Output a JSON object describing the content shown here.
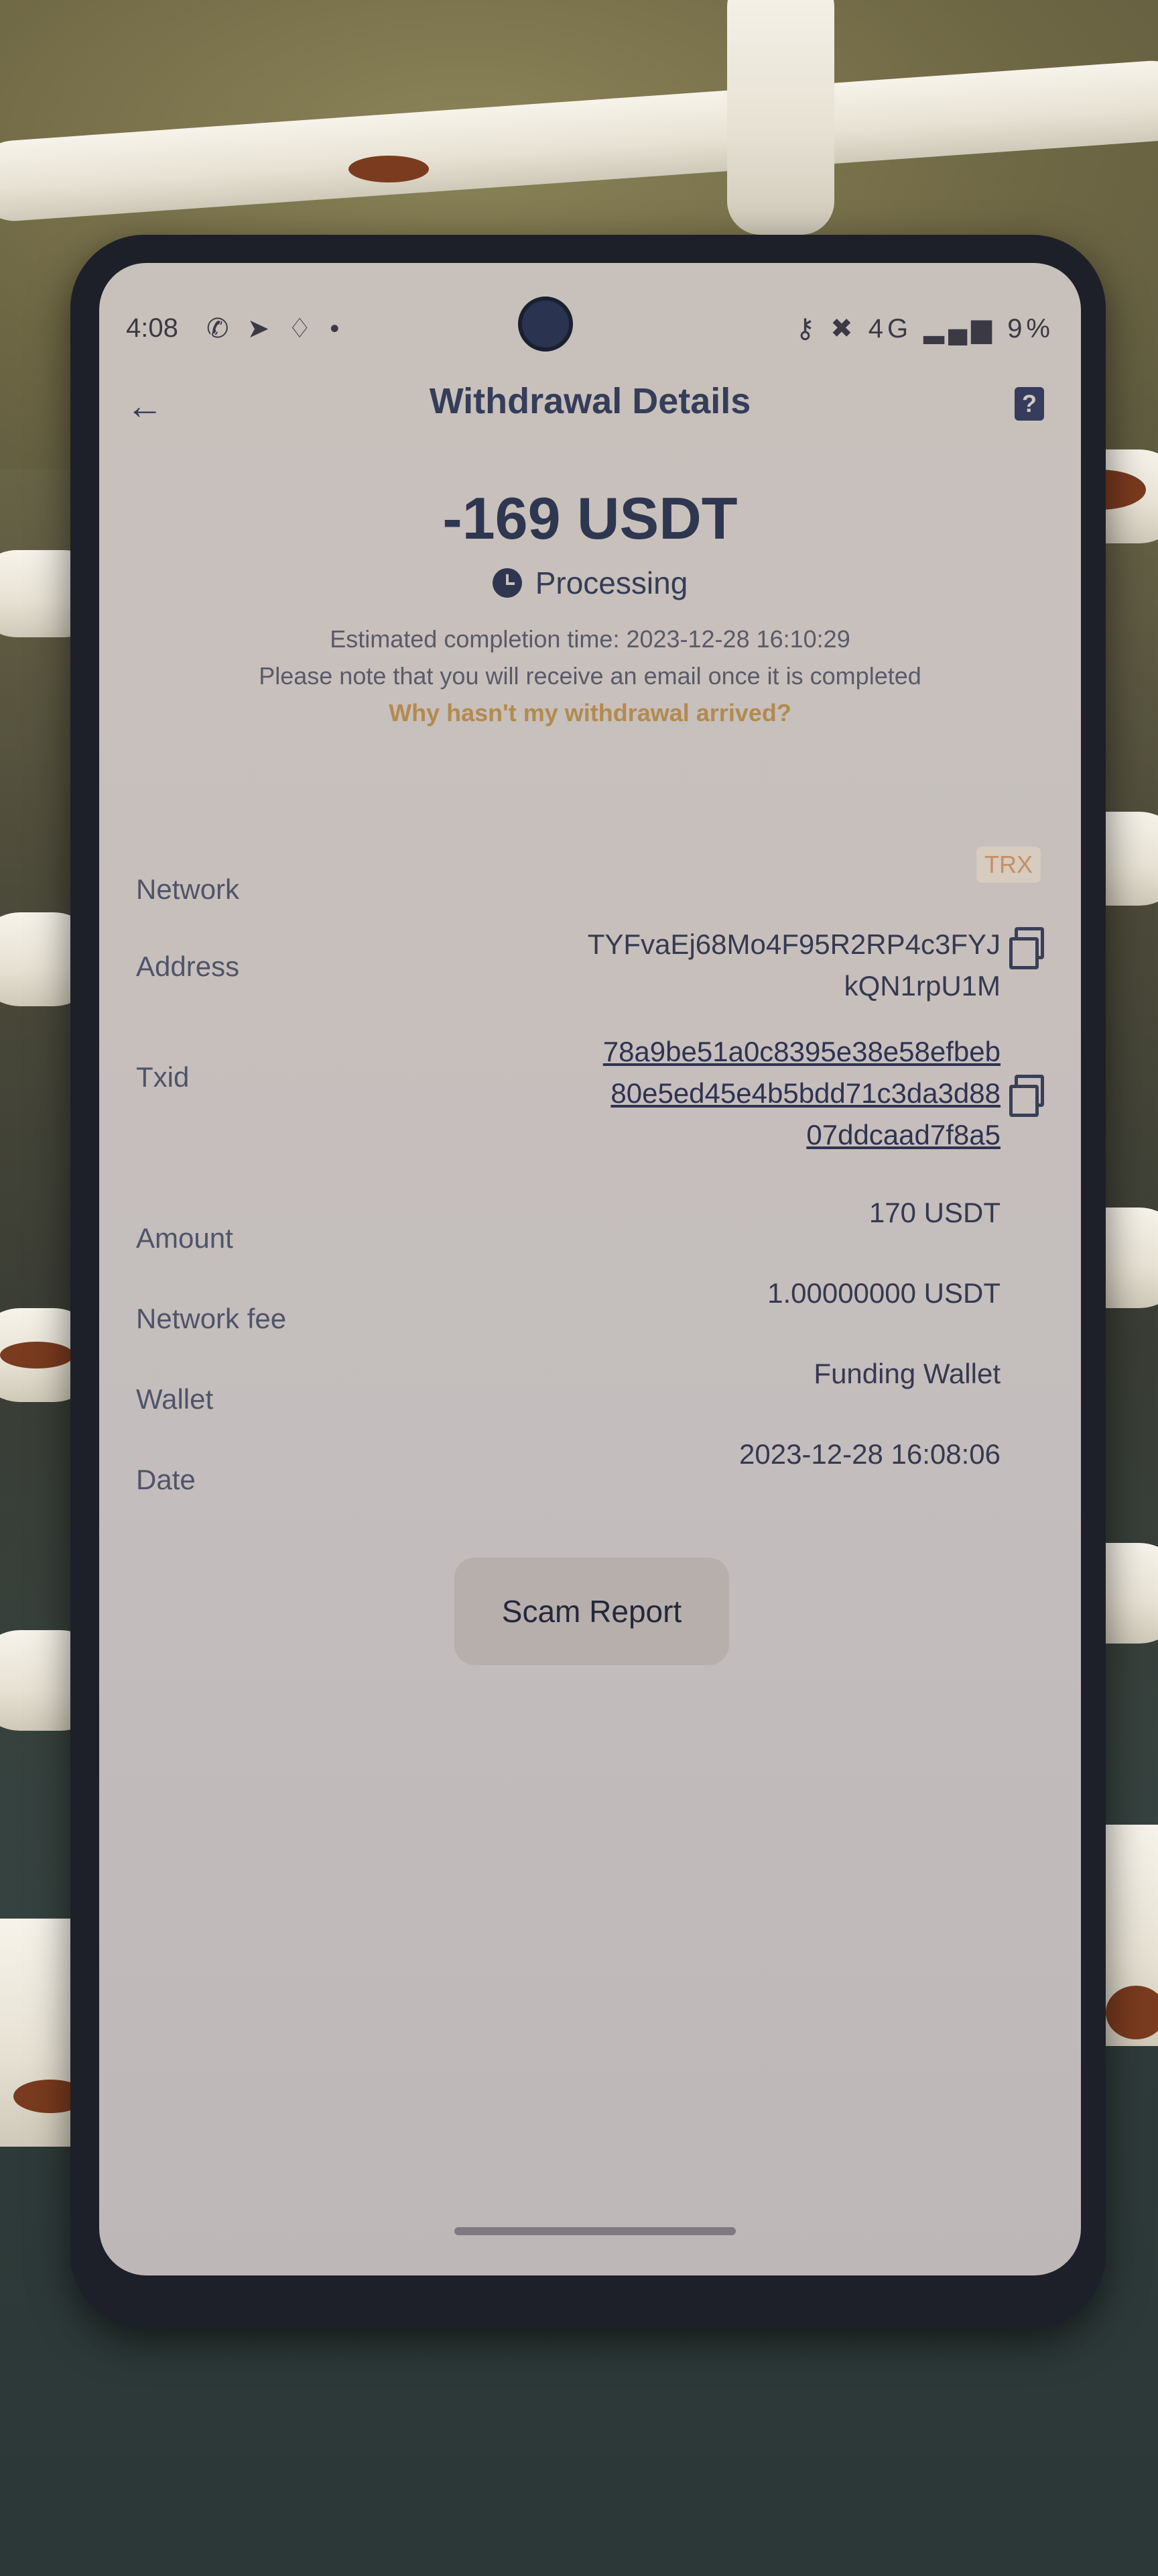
{
  "status_bar": {
    "time": "4:08",
    "app_icons": "✆ ➤ ♢ •",
    "right_icons": "⚷ ✖ 4G ▂▄▆",
    "battery": "9%"
  },
  "header": {
    "title": "Withdrawal Details",
    "back_icon": "←",
    "help_icon": "?"
  },
  "summary": {
    "amount": "-169 USDT",
    "status": "Processing",
    "estimated": "Estimated completion time: 2023-12-28 16:10:29",
    "note": "Please note that you will receive an email once it is completed",
    "why_link": "Why hasn't my withdrawal arrived?"
  },
  "details": {
    "network_label": "Network",
    "network_value": "TRX",
    "address_label": "Address",
    "address_line1": "TYFvaEj68Mo4F95R2RP4c3FYJ",
    "address_line2": "kQN1rpU1M",
    "txid_label": "Txid",
    "txid_line1": "78a9be51a0c8395e38e58efbeb",
    "txid_line2": "80e5ed45e4b5bdd71c3da3d88",
    "txid_line3": "07ddcaad7f8a5",
    "amount_label": "Amount",
    "amount_value": "170 USDT",
    "fee_label": "Network fee",
    "fee_value": "1.00000000 USDT",
    "wallet_label": "Wallet",
    "wallet_value": "Funding Wallet",
    "date_label": "Date",
    "date_value": "2023-12-28 16:08:06"
  },
  "actions": {
    "scam_report": "Scam Report"
  }
}
